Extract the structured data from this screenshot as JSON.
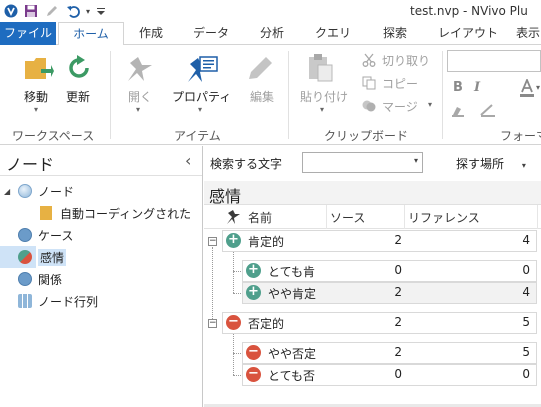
{
  "window": {
    "title": "test.nvp - NVivo Plu"
  },
  "tabs": [
    {
      "label": "ファイル"
    },
    {
      "label": "ホーム"
    },
    {
      "label": "作成"
    },
    {
      "label": "データ"
    },
    {
      "label": "分析"
    },
    {
      "label": "クエリ"
    },
    {
      "label": "探索"
    },
    {
      "label": "レイアウト"
    },
    {
      "label": "表示"
    }
  ],
  "ribbon": {
    "workspace": {
      "move": "移動",
      "refresh": "更新",
      "group": "ワークスペース"
    },
    "item": {
      "open": "開く",
      "properties": "プロパティ",
      "edit": "編集",
      "group": "アイテム"
    },
    "clipboard": {
      "paste": "貼り付け",
      "cut": "切り取り",
      "copy": "コピー",
      "merge": "マージ",
      "group": "クリップボード"
    },
    "format": {
      "group": "フォーマ",
      "bold": "B",
      "italic": "I"
    }
  },
  "nav": {
    "title": "ノード",
    "collapse_glyph": "‹",
    "items": [
      {
        "label": "ノード",
        "expander": "◢"
      },
      {
        "label": "自動コーディングされた"
      },
      {
        "label": "ケース"
      },
      {
        "label": "感情"
      },
      {
        "label": "関係"
      },
      {
        "label": "ノード行列"
      }
    ]
  },
  "toolbar": {
    "search_label": "検索する文字",
    "search_value": "",
    "search_in": "探す場所"
  },
  "content": {
    "title": "感情",
    "columns": {
      "name": "名前",
      "sources": "ソース",
      "references": "リファレンス"
    },
    "rows": [
      {
        "name": "肯定的",
        "sources": "2",
        "references": "4",
        "sign": "+"
      },
      {
        "name": "とても肯",
        "sources": "0",
        "references": "0",
        "sign": "+"
      },
      {
        "name": "やや肯定",
        "sources": "2",
        "references": "4",
        "sign": "+"
      },
      {
        "name": "否定的",
        "sources": "2",
        "references": "5",
        "sign": "−"
      },
      {
        "name": "やや否定",
        "sources": "2",
        "references": "5",
        "sign": "−"
      },
      {
        "name": "とても否",
        "sources": "0",
        "references": "0",
        "sign": "−"
      }
    ],
    "expander_minus": "−"
  },
  "colors": {
    "file_tab": "#1e6cc0",
    "positive": "#4f9f8c",
    "negative": "#d9533e",
    "selection": "#cfe3f7"
  }
}
